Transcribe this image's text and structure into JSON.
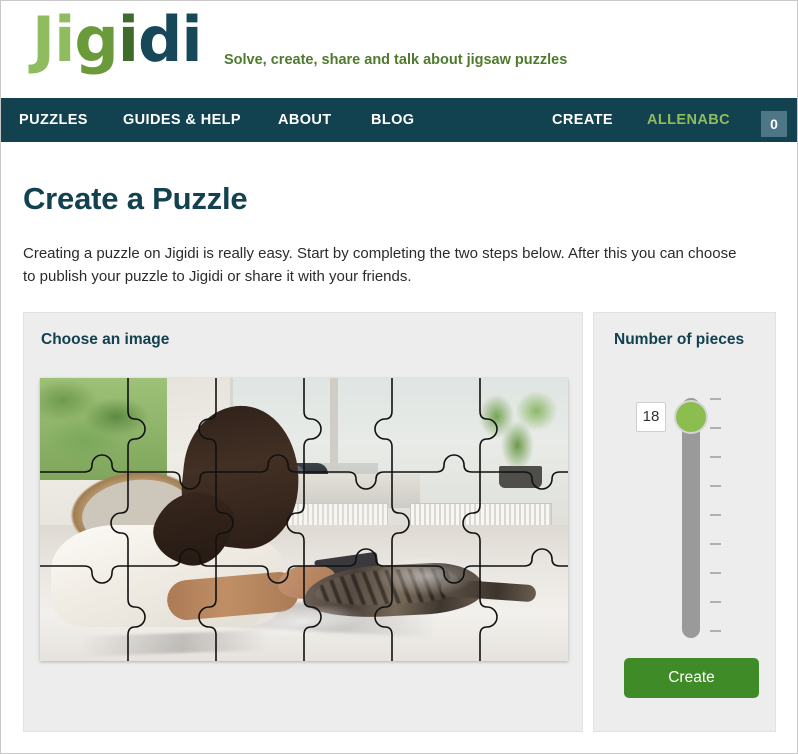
{
  "header": {
    "logo_letters": [
      {
        "char": "J",
        "color": "#8fbc5e"
      },
      {
        "char": "i",
        "color": "#8fbc5e"
      },
      {
        "char": "g",
        "color": "#6a9a3a"
      },
      {
        "char": "i",
        "color": "#3f6b2b"
      },
      {
        "char": "d",
        "color": "#16485a"
      },
      {
        "char": "i",
        "color": "#16485a"
      }
    ],
    "logo_text": "Jigidi",
    "tagline": "Solve, create, share and talk about jigsaw puzzles"
  },
  "nav": {
    "background": "#12414f",
    "items": [
      {
        "label": "PUZZLES",
        "highlight": false
      },
      {
        "label": "GUIDES & HELP",
        "highlight": false
      },
      {
        "label": "ABOUT",
        "highlight": false
      },
      {
        "label": "BLOG",
        "highlight": false
      },
      {
        "label": "CREATE",
        "highlight": false
      },
      {
        "label": "ALLENABC",
        "highlight": true
      }
    ],
    "badge_count": "0",
    "badge_color": "#4d7787",
    "highlight_color": "#8fbc5e"
  },
  "main": {
    "title": "Create a Puzzle",
    "intro": "Creating a puzzle on Jigidi is really easy. Start by completing the two steps below. After this you can choose to publish your puzzle to Jigidi or share it with your friends.",
    "left_panel": {
      "title": "Choose an image",
      "image_alt": "Child in white sweater lying on marble table beside a tabby cat, near a sunny window"
    },
    "right_panel": {
      "title": "Number of pieces",
      "slider": {
        "value": "18",
        "thumb_color": "#8cbd4f",
        "track_color": "#9a9a9a",
        "tick_count": 9,
        "orientation": "vertical"
      },
      "create_label": "Create",
      "create_color": "#3f8b28"
    }
  },
  "theme": {
    "panel_bg": "#ededed",
    "page_bg": "#ffffff",
    "title_color": "#12414f",
    "accent_green": "#8fbc5e"
  }
}
